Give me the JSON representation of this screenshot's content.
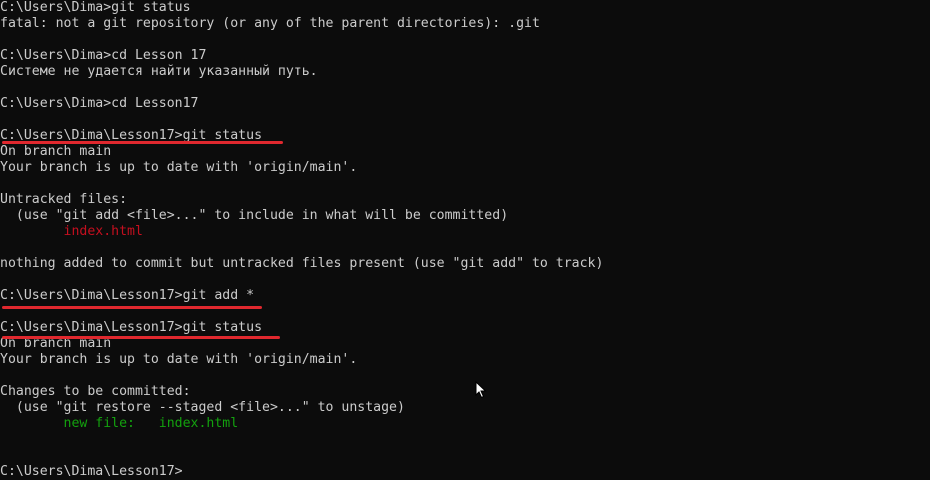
{
  "terminal": {
    "lines": [
      "C:\\Users\\Dima>git status",
      "fatal: not a git repository (or any of the parent directories): .git",
      "",
      "C:\\Users\\Dima>cd Lesson 17",
      "Системе не удается найти указанный путь.",
      "",
      "C:\\Users\\Dima>cd Lesson17",
      "",
      "C:\\Users\\Dima\\Lesson17>git status",
      "On branch main",
      "Your branch is up to date with 'origin/main'.",
      "",
      "Untracked files:",
      "  (use \"git add <file>...\" to include in what will be committed)",
      "        index.html",
      "",
      "nothing added to commit but untracked files present (use \"git add\" to track)",
      "",
      "C:\\Users\\Dima\\Lesson17>git add *",
      "",
      "C:\\Users\\Dima\\Lesson17>git status",
      "On branch main",
      "Your branch is up to date with 'origin/main'.",
      "",
      "Changes to be committed:",
      "  (use \"git restore --staged <file>...\" to unstage)",
      "        new file:   index.html",
      "",
      "",
      "C:\\Users\\Dima\\Lesson17>"
    ],
    "colors": {
      "background": "#0c0c0c",
      "text": "#cccccc",
      "untracked": "#c50f1f",
      "staged": "#13a10e",
      "annotation": "#e0282e"
    }
  }
}
